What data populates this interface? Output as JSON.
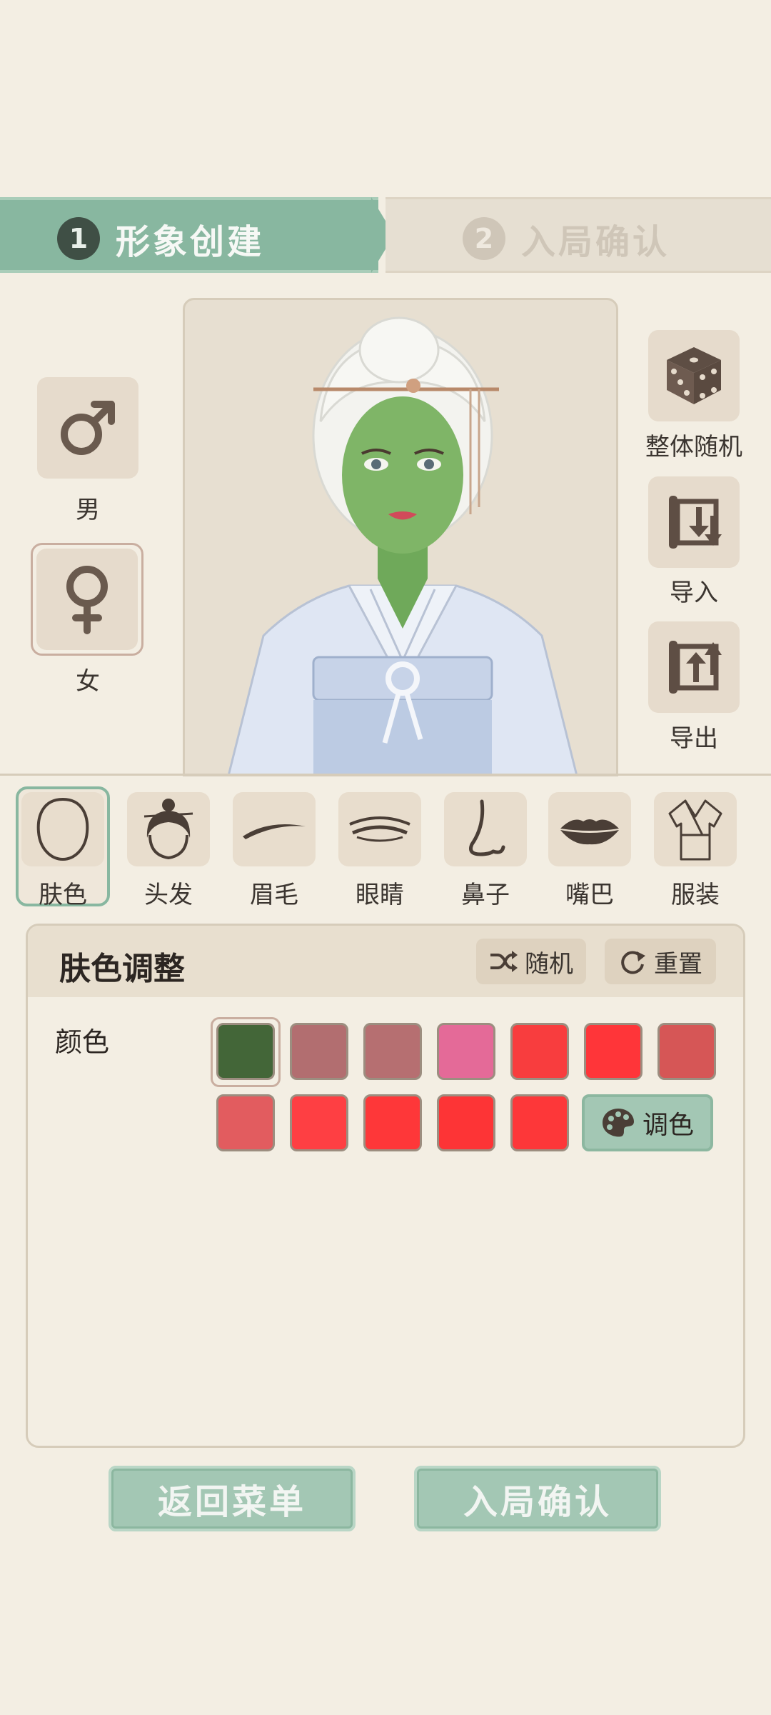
{
  "steps": [
    {
      "num": "1",
      "label": "形象创建"
    },
    {
      "num": "2",
      "label": "入局确认"
    }
  ],
  "gender": {
    "male_label": "男",
    "female_label": "女",
    "male_icon": "male-symbol-icon",
    "female_icon": "female-symbol-icon"
  },
  "actions": {
    "random_all": "整体随机",
    "import": "导入",
    "export": "导出"
  },
  "categories": [
    {
      "label": "肤色",
      "icon": "face-outline-icon",
      "selected": true
    },
    {
      "label": "头发",
      "icon": "hair-bun-icon"
    },
    {
      "label": "眉毛",
      "icon": "eyebrow-icon"
    },
    {
      "label": "眼睛",
      "icon": "eye-icon"
    },
    {
      "label": "鼻子",
      "icon": "nose-icon"
    },
    {
      "label": "嘴巴",
      "icon": "lips-icon"
    },
    {
      "label": "服装",
      "icon": "robe-icon"
    }
  ],
  "panel": {
    "title": "肤色调整",
    "random_label": "随机",
    "reset_label": "重置",
    "color_label": "颜色",
    "palette_label": "调色",
    "swatches_row1": [
      "#436638",
      "#b26e70",
      "#b66f71",
      "#e46a98",
      "#f83d3e",
      "#ff3539",
      "#d65656"
    ],
    "swatches_row2": [
      "#e25c5f",
      "#fe3f43",
      "#fe3739",
      "#fd3436",
      "#fd3739"
    ],
    "selected_swatch": 0
  },
  "bottom": {
    "back_label": "返回菜单",
    "confirm_label": "入局确认"
  }
}
